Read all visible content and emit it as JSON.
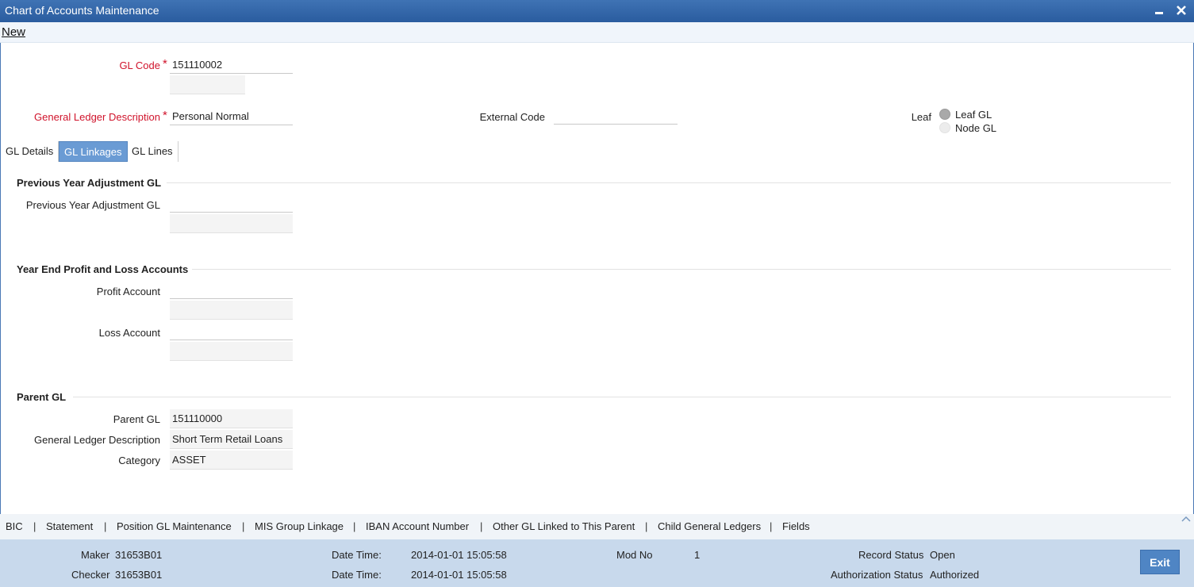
{
  "window": {
    "title": "Chart of Accounts Maintenance",
    "minimize_icon": "minimize-icon",
    "close_icon": "close-icon"
  },
  "menu": {
    "new_label": "New"
  },
  "header": {
    "gl_code": {
      "label": "GL Code",
      "required": "*",
      "value": "151110002"
    },
    "gl_description": {
      "label": "General Ledger Description",
      "required": "*",
      "value": "Personal Normal"
    },
    "external_code": {
      "label": "External Code",
      "value": ""
    },
    "leaf": {
      "label": "Leaf",
      "options": [
        "Leaf GL",
        "Node GL"
      ],
      "selected": "Leaf GL"
    }
  },
  "tabs": [
    {
      "label": "GL Details"
    },
    {
      "label": "GL Linkages"
    },
    {
      "label": "GL Lines"
    }
  ],
  "active_tab": "GL Linkages",
  "sections": {
    "prev_year": {
      "title": "Previous Year Adjustment GL",
      "field_label": "Previous Year Adjustment GL",
      "value": ""
    },
    "pnl": {
      "title": "Year End Profit and Loss Accounts",
      "profit_label": "Profit Account",
      "profit_value": "",
      "loss_label": "Loss Account",
      "loss_value": ""
    },
    "parent": {
      "title": "Parent GL",
      "parent_gl_label": "Parent GL",
      "parent_gl_value": "151110000",
      "description_label": "General Ledger Description",
      "description_value": "Short Term Retail Loans",
      "category_label": "Category",
      "category_value": "ASSET"
    }
  },
  "bottom_links": [
    "BIC",
    "Statement",
    "Position GL Maintenance",
    "MIS Group Linkage",
    "IBAN Account Number",
    "Other GL Linked to This Parent",
    "Child General Ledgers",
    "Fields"
  ],
  "bottom_separator": "|",
  "audit": {
    "maker_label": "Maker",
    "maker_value": "31653B01",
    "checker_label": "Checker",
    "checker_value": "31653B01",
    "maker_dt_label": "Date Time:",
    "maker_dt_value": "2014-01-01 15:05:58",
    "checker_dt_label": "Date Time:",
    "checker_dt_value": "2014-01-01 15:05:58",
    "mod_no_label": "Mod No",
    "mod_no_value": "1",
    "record_status_label": "Record Status",
    "record_status_value": "Open",
    "auth_status_label": "Authorization Status",
    "auth_status_value": "Authorized"
  },
  "exit_label": "Exit",
  "colors": {
    "titlebar": "#2a5c9f",
    "active_tab": "#6a9bd4",
    "audit_bg": "#c8d9ec",
    "required": "#d0132b",
    "exit_button": "#4f85c4"
  }
}
